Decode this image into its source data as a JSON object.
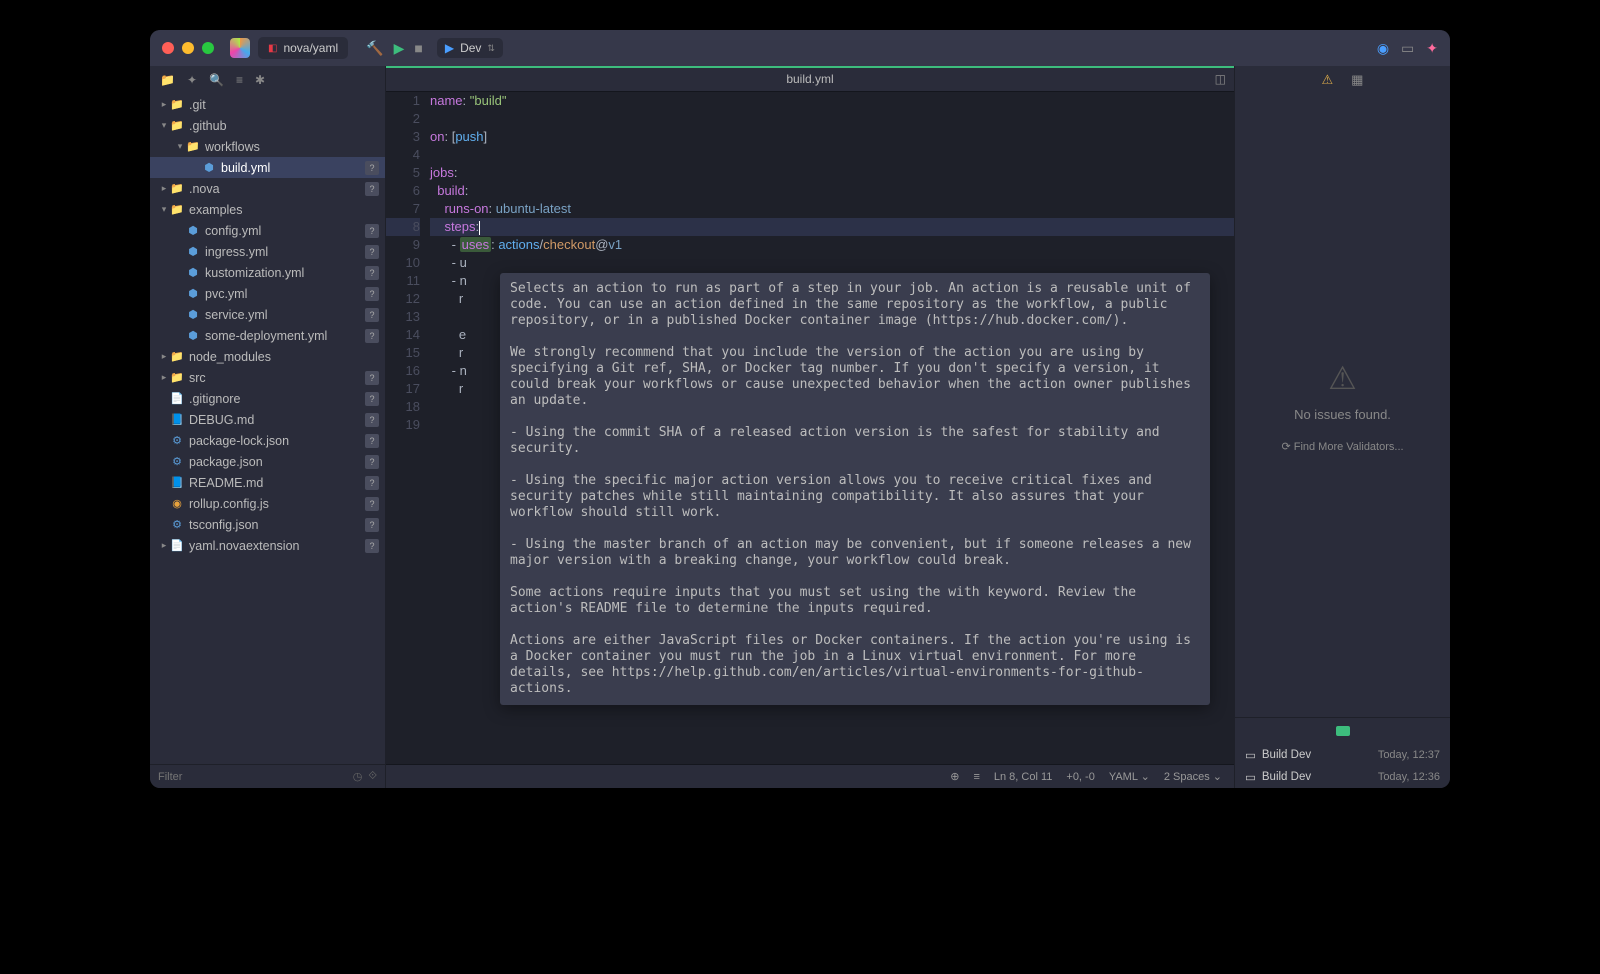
{
  "titlebar": {
    "project": "nova/yaml",
    "runConfig": "Dev"
  },
  "sidebar": {
    "tools": [
      "📁",
      "✦",
      "🔍",
      "≡",
      "✱"
    ],
    "filterPlaceholder": "Filter",
    "tree": [
      {
        "d": 0,
        "chev": "▸",
        "icon": "📁",
        "cls": "folder",
        "name": ".git",
        "badge": ""
      },
      {
        "d": 0,
        "chev": "▾",
        "icon": "📁",
        "cls": "folder",
        "name": ".github",
        "badge": ""
      },
      {
        "d": 1,
        "chev": "▾",
        "icon": "📁",
        "cls": "folder",
        "name": "workflows",
        "badge": ""
      },
      {
        "d": 2,
        "chev": "",
        "icon": "⬢",
        "cls": "yml",
        "name": "build.yml",
        "badge": "?",
        "sel": true
      },
      {
        "d": 0,
        "chev": "▸",
        "icon": "📁",
        "cls": "folder",
        "name": ".nova",
        "badge": "?"
      },
      {
        "d": 0,
        "chev": "▾",
        "icon": "📁",
        "cls": "folder",
        "name": "examples",
        "badge": ""
      },
      {
        "d": 1,
        "chev": "",
        "icon": "⬢",
        "cls": "yml",
        "name": "config.yml",
        "badge": "?"
      },
      {
        "d": 1,
        "chev": "",
        "icon": "⬢",
        "cls": "yml",
        "name": "ingress.yml",
        "badge": "?"
      },
      {
        "d": 1,
        "chev": "",
        "icon": "⬢",
        "cls": "yml",
        "name": "kustomization.yml",
        "badge": "?"
      },
      {
        "d": 1,
        "chev": "",
        "icon": "⬢",
        "cls": "yml",
        "name": "pvc.yml",
        "badge": "?"
      },
      {
        "d": 1,
        "chev": "",
        "icon": "⬢",
        "cls": "yml",
        "name": "service.yml",
        "badge": "?"
      },
      {
        "d": 1,
        "chev": "",
        "icon": "⬢",
        "cls": "yml",
        "name": "some-deployment.yml",
        "badge": "?"
      },
      {
        "d": 0,
        "chev": "▸",
        "icon": "📁",
        "cls": "folder",
        "name": "node_modules",
        "badge": ""
      },
      {
        "d": 0,
        "chev": "▸",
        "icon": "📁",
        "cls": "folder",
        "name": "src",
        "badge": "?"
      },
      {
        "d": 0,
        "chev": "",
        "icon": "📄",
        "cls": "txt",
        "name": ".gitignore",
        "badge": "?"
      },
      {
        "d": 0,
        "chev": "",
        "icon": "📘",
        "cls": "md",
        "name": "DEBUG.md",
        "badge": "?"
      },
      {
        "d": 0,
        "chev": "",
        "icon": "⚙",
        "cls": "json",
        "name": "package-lock.json",
        "badge": "?"
      },
      {
        "d": 0,
        "chev": "",
        "icon": "⚙",
        "cls": "json",
        "name": "package.json",
        "badge": "?"
      },
      {
        "d": 0,
        "chev": "",
        "icon": "📘",
        "cls": "md",
        "name": "README.md",
        "badge": "?"
      },
      {
        "d": 0,
        "chev": "",
        "icon": "◉",
        "cls": "js",
        "name": "rollup.config.js",
        "badge": "?"
      },
      {
        "d": 0,
        "chev": "",
        "icon": "⚙",
        "cls": "json",
        "name": "tsconfig.json",
        "badge": "?"
      },
      {
        "d": 0,
        "chev": "▸",
        "icon": "📄",
        "cls": "txt",
        "name": "yaml.novaextension",
        "badge": "?"
      }
    ]
  },
  "editor": {
    "filename": "build.yml",
    "lineCount": 19,
    "activeLine": 8,
    "tooltip": "Selects an action to run as part of a step in your job. An action is a reusable unit of code. You can use an action defined in the same repository as the workflow, a public repository, or in a published Docker container image (https://hub.docker.com/).\n\nWe strongly recommend that you include the version of the action you are using by specifying a Git ref, SHA, or Docker tag number. If you don't specify a version, it could break your workflows or cause unexpected behavior when the action owner publishes an update.\n\n- Using the commit SHA of a released action version is the safest for stability and security.\n\n- Using the specific major action version allows you to receive critical fixes and security patches while still maintaining compatibility. It also assures that your workflow should still work.\n\n- Using the master branch of an action may be convenient, but if someone releases a new major version with a breaking change, your workflow could break.\n\nSome actions require inputs that you must set using the with keyword. Review the action's README file to determine the inputs required.\n\nActions are either JavaScript files or Docker containers. If the action you're using is a Docker container you must run the job in a Linux virtual environment. For more details, see https://help.github.com/en/articles/virtual-environments-for-github-actions.",
    "code": {
      "l1": {
        "a": "name",
        "b": ": ",
        "c": "\"build\""
      },
      "l3": {
        "a": "on",
        "b": ": [",
        "c": "push",
        "d": "]"
      },
      "l5": {
        "a": "jobs",
        "b": ":"
      },
      "l6": {
        "a": "  build",
        "b": ":"
      },
      "l7": {
        "a": "    runs-on",
        "b": ": ",
        "c": "ubuntu-latest"
      },
      "l8": {
        "a": "    steps",
        "b": ":"
      },
      "l9": {
        "a": "      - ",
        "b": "uses",
        "c": ": ",
        "d": "actions",
        "e": "/",
        "f": "checkout",
        "g": "@",
        "h": "v1"
      },
      "l10": {
        "a": "      - u"
      },
      "l11": {
        "a": "      - n"
      },
      "l12": {
        "a": "        r"
      },
      "l14": {
        "a": "        e"
      },
      "l15": {
        "a": "        r"
      },
      "l16": {
        "a": "      - n"
      },
      "l17": {
        "a": "        r"
      }
    }
  },
  "status": {
    "pos": "Ln 8, Col 11",
    "diff": "+0, -0",
    "lang": "YAML",
    "indent": "2 Spaces"
  },
  "issues": {
    "msg": "No issues found.",
    "link": "Find More Validators..."
  },
  "tasks": [
    {
      "name": "Build Dev",
      "time": "Today, 12:37"
    },
    {
      "name": "Build Dev",
      "time": "Today, 12:36"
    }
  ]
}
